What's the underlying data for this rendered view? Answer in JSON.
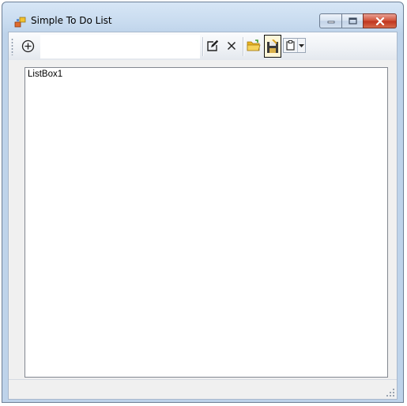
{
  "window": {
    "title": "Simple To Do List"
  },
  "toolbar": {
    "add_icon": "plus-circle-icon",
    "task_input_value": "",
    "edit_icon": "edit-icon",
    "delete_icon": "close-icon",
    "open_icon": "folder-icon",
    "save_icon": "save-disk-icon",
    "clear_icon": "clipboard-icon"
  },
  "list": {
    "items": [
      "ListBox1"
    ]
  },
  "colors": {
    "title_text": "#000000",
    "close_button": "#c8422c",
    "listbox_border": "#828790"
  }
}
